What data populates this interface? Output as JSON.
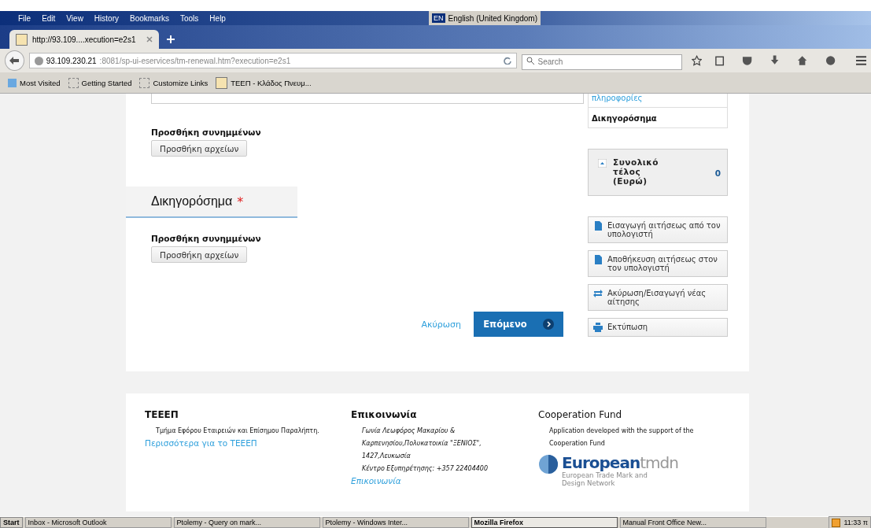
{
  "menu_bar": {
    "items": [
      "File",
      "Edit",
      "View",
      "History",
      "Bookmarks",
      "Tools",
      "Help"
    ],
    "language": {
      "code": "EN",
      "label": "English (United Kingdom)"
    }
  },
  "tabs": [
    {
      "title": "http://93.109....xecution=e2s1",
      "selected": true
    }
  ],
  "address_bar": {
    "host": "93.109.230.21",
    "path": ":8081/sp-ui-eservices/tm-renewal.htm?execution=e2s1"
  },
  "search": {
    "placeholder": "Search"
  },
  "bookmarks": [
    "Most Visited",
    "Getting Started",
    "Customize Links",
    "ΤΕΕΠ - Κλάδος Πνευμ..."
  ],
  "form": {
    "sections": [
      {
        "attachments_label": "Προσθήκη συνημμένων",
        "button": "Προσθήκη αρχείων"
      },
      {
        "title": "Δικηγορόσημα",
        "required_mark": "*",
        "attachments_label": "Προσθήκη συνημμένων",
        "button": "Προσθήκη αρχείων"
      }
    ],
    "cancel": "Ακύρωση",
    "next": "Επόμενο"
  },
  "sidebar": {
    "steps": [
      {
        "label": "πληροφορίες",
        "selected": false
      },
      {
        "label": "Δικηγορόσημα",
        "selected": true
      }
    ],
    "total": {
      "label": "Συνολικό τέλος (Ευρώ)",
      "value": "0"
    },
    "actions": [
      {
        "kind": "import",
        "label": "Εισαγωγή αιτήσεως από τον υπολογιστή"
      },
      {
        "kind": "save",
        "label": "Αποθήκευση αιτήσεως στον τον υπολογιστή"
      },
      {
        "kind": "reset",
        "label": "Ακύρωση/Εισαγωγή νέας αίτησης"
      },
      {
        "kind": "print",
        "label": "Εκτύπωση"
      }
    ]
  },
  "footer": {
    "columns": [
      {
        "title": "ΤΕΕΕΠ",
        "lines": [
          "Τμήμα Εφόρου Εταιρειών και Επίσημου Παραλήπτη."
        ],
        "link": "Περισσότερα για το ΤΕΕΕΠ"
      },
      {
        "title": "Επικοινωνία",
        "lines": [
          "Γωνία Λεωφόρος Μακαρίου &",
          "Καρπενησίου,Πολυκατοικία \"ΞΕΝΙΟΣ\",",
          "1427,Λευκωσία",
          "Κέντρο Εξυπηρέτησης: +357 22404400"
        ],
        "link": "Επικοινωνία"
      },
      {
        "title": "Cooperation Fund",
        "lines": [
          "Application developed with the support of the",
          "Cooperation Fund"
        ],
        "logo": {
          "word": "European",
          "suffix": "tmdn",
          "subtitle": "European Trade Mark and Design Network"
        }
      }
    ]
  },
  "taskbar": {
    "start": "Start",
    "items": [
      {
        "label": "Inbox - Microsoft Outlook",
        "selected": false
      },
      {
        "label": "Ptolemy - Query on mark...",
        "selected": false
      },
      {
        "label": "Ptolemy - Windows Inter...",
        "selected": false
      },
      {
        "label": "Mozilla Firefox",
        "selected": true
      },
      {
        "label": "Manual Front Office New...",
        "selected": false
      }
    ],
    "clock": "11:33 π"
  }
}
